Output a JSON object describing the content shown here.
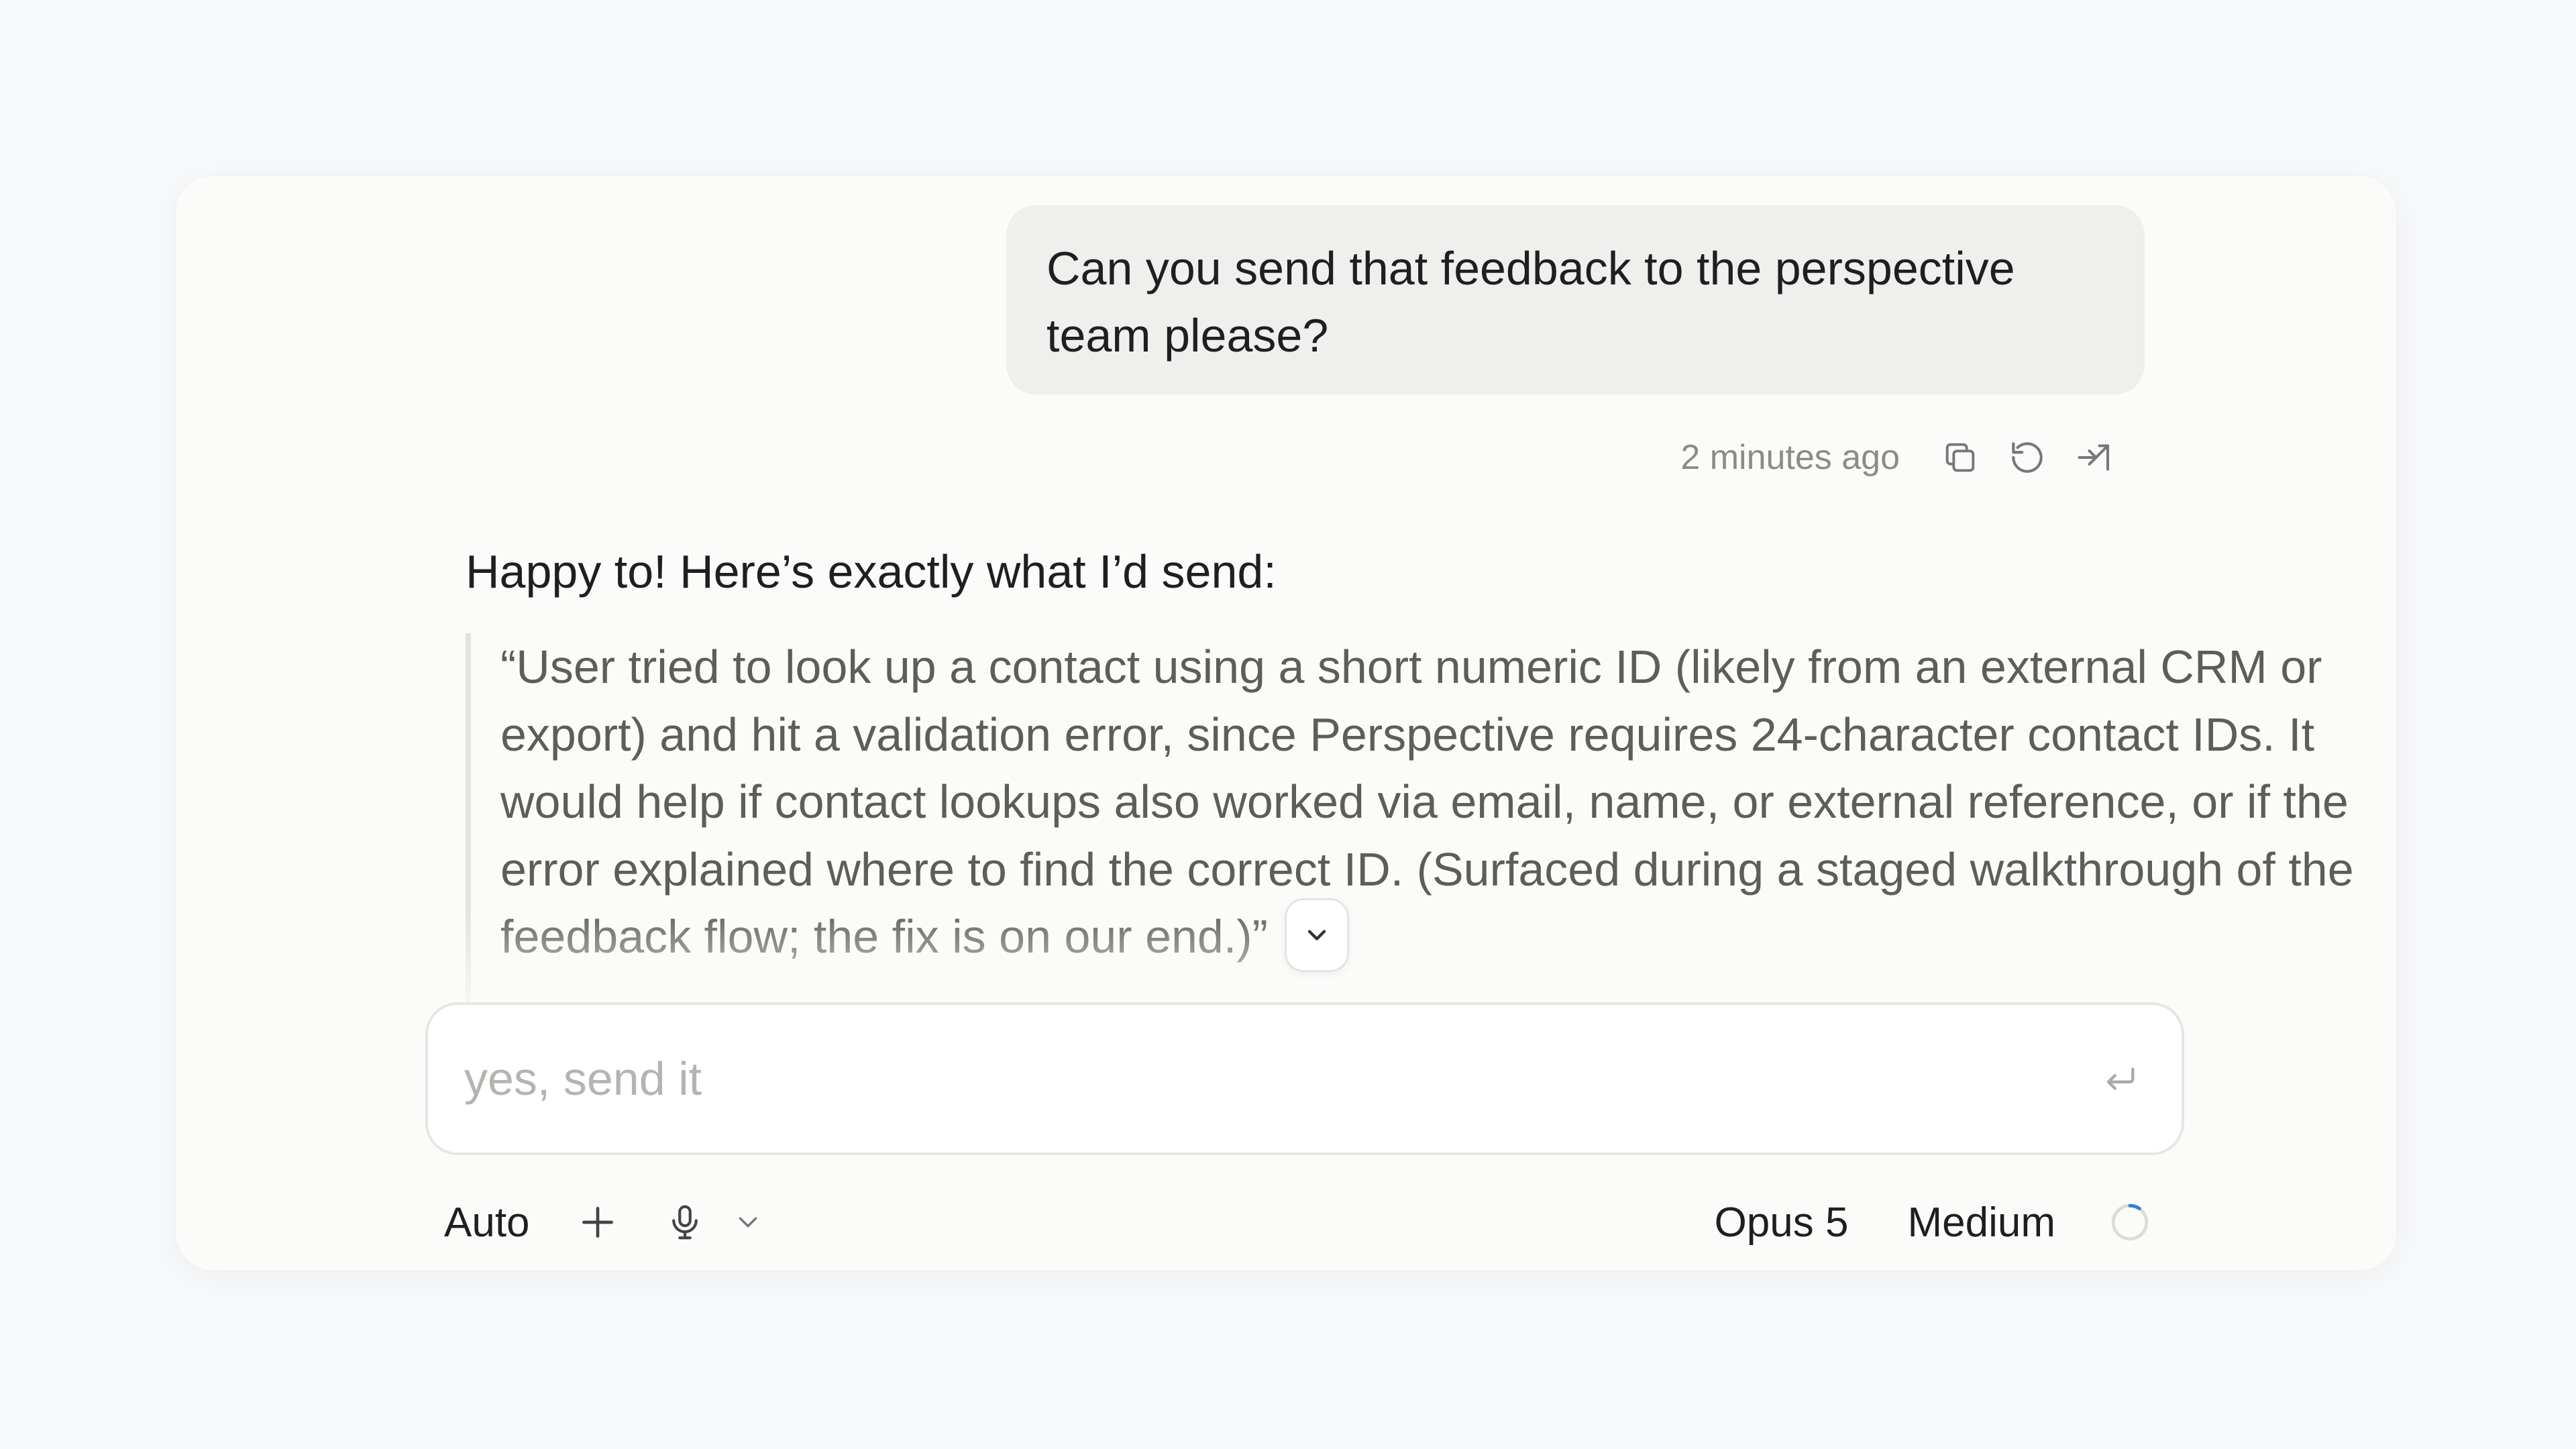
{
  "conversation": {
    "user_message": "Can you send that feedback to the perspective team please?",
    "timestamp": "2 minutes ago",
    "assistant_intro": "Happy to! Here’s exactly what I’d send:",
    "assistant_quote": "“User tried to look up a contact using a short numeric ID (likely from an external CRM or export) and hit a validation error, since Perspective requires 24-character contact IDs. It would help if contact lookups also worked via email, name, or external reference, or if the error explained where to find the correct ID. (Surfaced during a staged walkthrough of the feedback flow; the fix is on our end.)”"
  },
  "composer": {
    "placeholder": "yes, send it"
  },
  "toolbar": {
    "mode_label": "Auto",
    "model_label": "Opus 5",
    "effort_label": "Medium"
  },
  "icons": {
    "copy": "copy-icon",
    "retry": "retry-icon",
    "branch": "branch-icon",
    "scroll_down": "chevron-down-icon",
    "enter": "enter-icon",
    "plus": "plus-icon",
    "mic": "microphone-icon",
    "dropdown": "chevron-down-icon",
    "loading": "loading-spinner-icon"
  },
  "colors": {
    "accent": "#2f7de1",
    "background": "#f7f8fa",
    "card": "#fbfbfa",
    "user_bubble": "#efefed"
  }
}
